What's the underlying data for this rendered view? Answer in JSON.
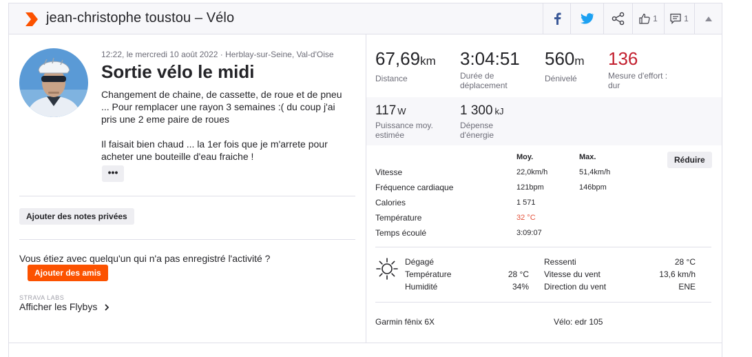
{
  "header": {
    "title": "jean-christophe toustou – Vélo",
    "kudos_count": "1",
    "comments_count": "1"
  },
  "colors": {
    "accent": "#fc5200",
    "effort": "#c3202f",
    "temp": "#e4513a",
    "facebook": "#3b5998",
    "twitter": "#1da1f2"
  },
  "activity": {
    "meta": "12:22, le mercredi 10 août 2022 · Herblay-sur-Seine, Val-d'Oise",
    "title": "Sortie vélo le midi",
    "description": [
      "Changement de chaine, de cassette, de roue et de pneu\n... Pour remplacer une rayon 3 semaines :( du coup j'ai\npris une 2 eme paire de roues",
      "Il faisait bien chaud ... la 1er fois que je m'arrete pour\nacheter une bouteille d'eau fraiche !"
    ],
    "more_label": "•••",
    "private_notes_label": "Ajouter des notes privées",
    "with_question": "Vous étiez avec quelqu'un qui n'a pas enregistré l'activité ?",
    "add_friends_label": "Ajouter des amis",
    "labs_label": "STRAVA LABS",
    "flybys_label": "Afficher les Flybys"
  },
  "stats": {
    "distance": {
      "value": "67,69",
      "unit": "km",
      "label": "Distance"
    },
    "moving_time": {
      "value": "3:04:51",
      "label": "Durée de\ndéplacement"
    },
    "elevation": {
      "value": "560",
      "unit": "m",
      "label": "Dénivelé"
    },
    "effort": {
      "value": "136",
      "label": "Mesure d'effort :\ndur"
    },
    "power": {
      "value": "117",
      "unit": "W",
      "label": "Puissance moy.\nestimée"
    },
    "energy": {
      "value": "1 300",
      "unit": "kJ",
      "label": "Dépense\nd'énergie"
    }
  },
  "details": {
    "col_avg": "Moy.",
    "col_max": "Max.",
    "reduce_label": "Réduire",
    "rows": [
      {
        "label": "Vitesse",
        "avg": "22,0km/h",
        "max": "51,4km/h"
      },
      {
        "label": "Fréquence cardiaque",
        "avg": "121bpm",
        "max": "146bpm"
      },
      {
        "label": "Calories",
        "avg": "1 571",
        "max": ""
      },
      {
        "label": "Température",
        "avg": "32 °C",
        "max": ""
      },
      {
        "label": "Temps écoulé",
        "avg": "3:09:07",
        "max": ""
      }
    ]
  },
  "weather": {
    "icon": "sun-icon",
    "condition": "Dégagé",
    "temp_label": "Température",
    "temp_value": "28 °C",
    "humidity_label": "Humidité",
    "humidity_value": "34%",
    "feels_label": "Ressenti",
    "feels_value": "28 °C",
    "wind_speed_label": "Vitesse du vent",
    "wind_speed_value": "13,6 km/h",
    "wind_dir_label": "Direction du vent",
    "wind_dir_value": "ENE"
  },
  "device": "Garmin fēnix 6X",
  "bike": "Vélo: edr 105"
}
